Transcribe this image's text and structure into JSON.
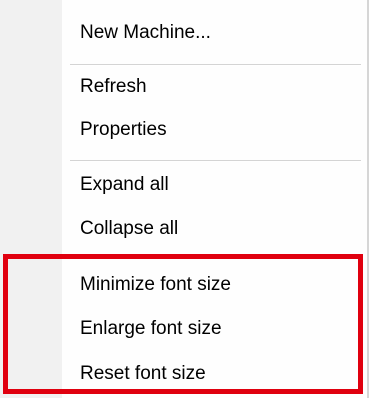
{
  "context_menu": {
    "items": [
      {
        "label": "New Machine..."
      },
      {
        "label": "Refresh"
      },
      {
        "label": "Properties"
      },
      {
        "label": "Expand all"
      },
      {
        "label": "Collapse all"
      },
      {
        "label": "Minimize font size"
      },
      {
        "label": "Enlarge font size"
      },
      {
        "label": "Reset font size"
      }
    ]
  },
  "colors": {
    "highlight_border": "#e0000f",
    "gutter": "#f1f1f1",
    "separator": "#d4d4d4"
  }
}
